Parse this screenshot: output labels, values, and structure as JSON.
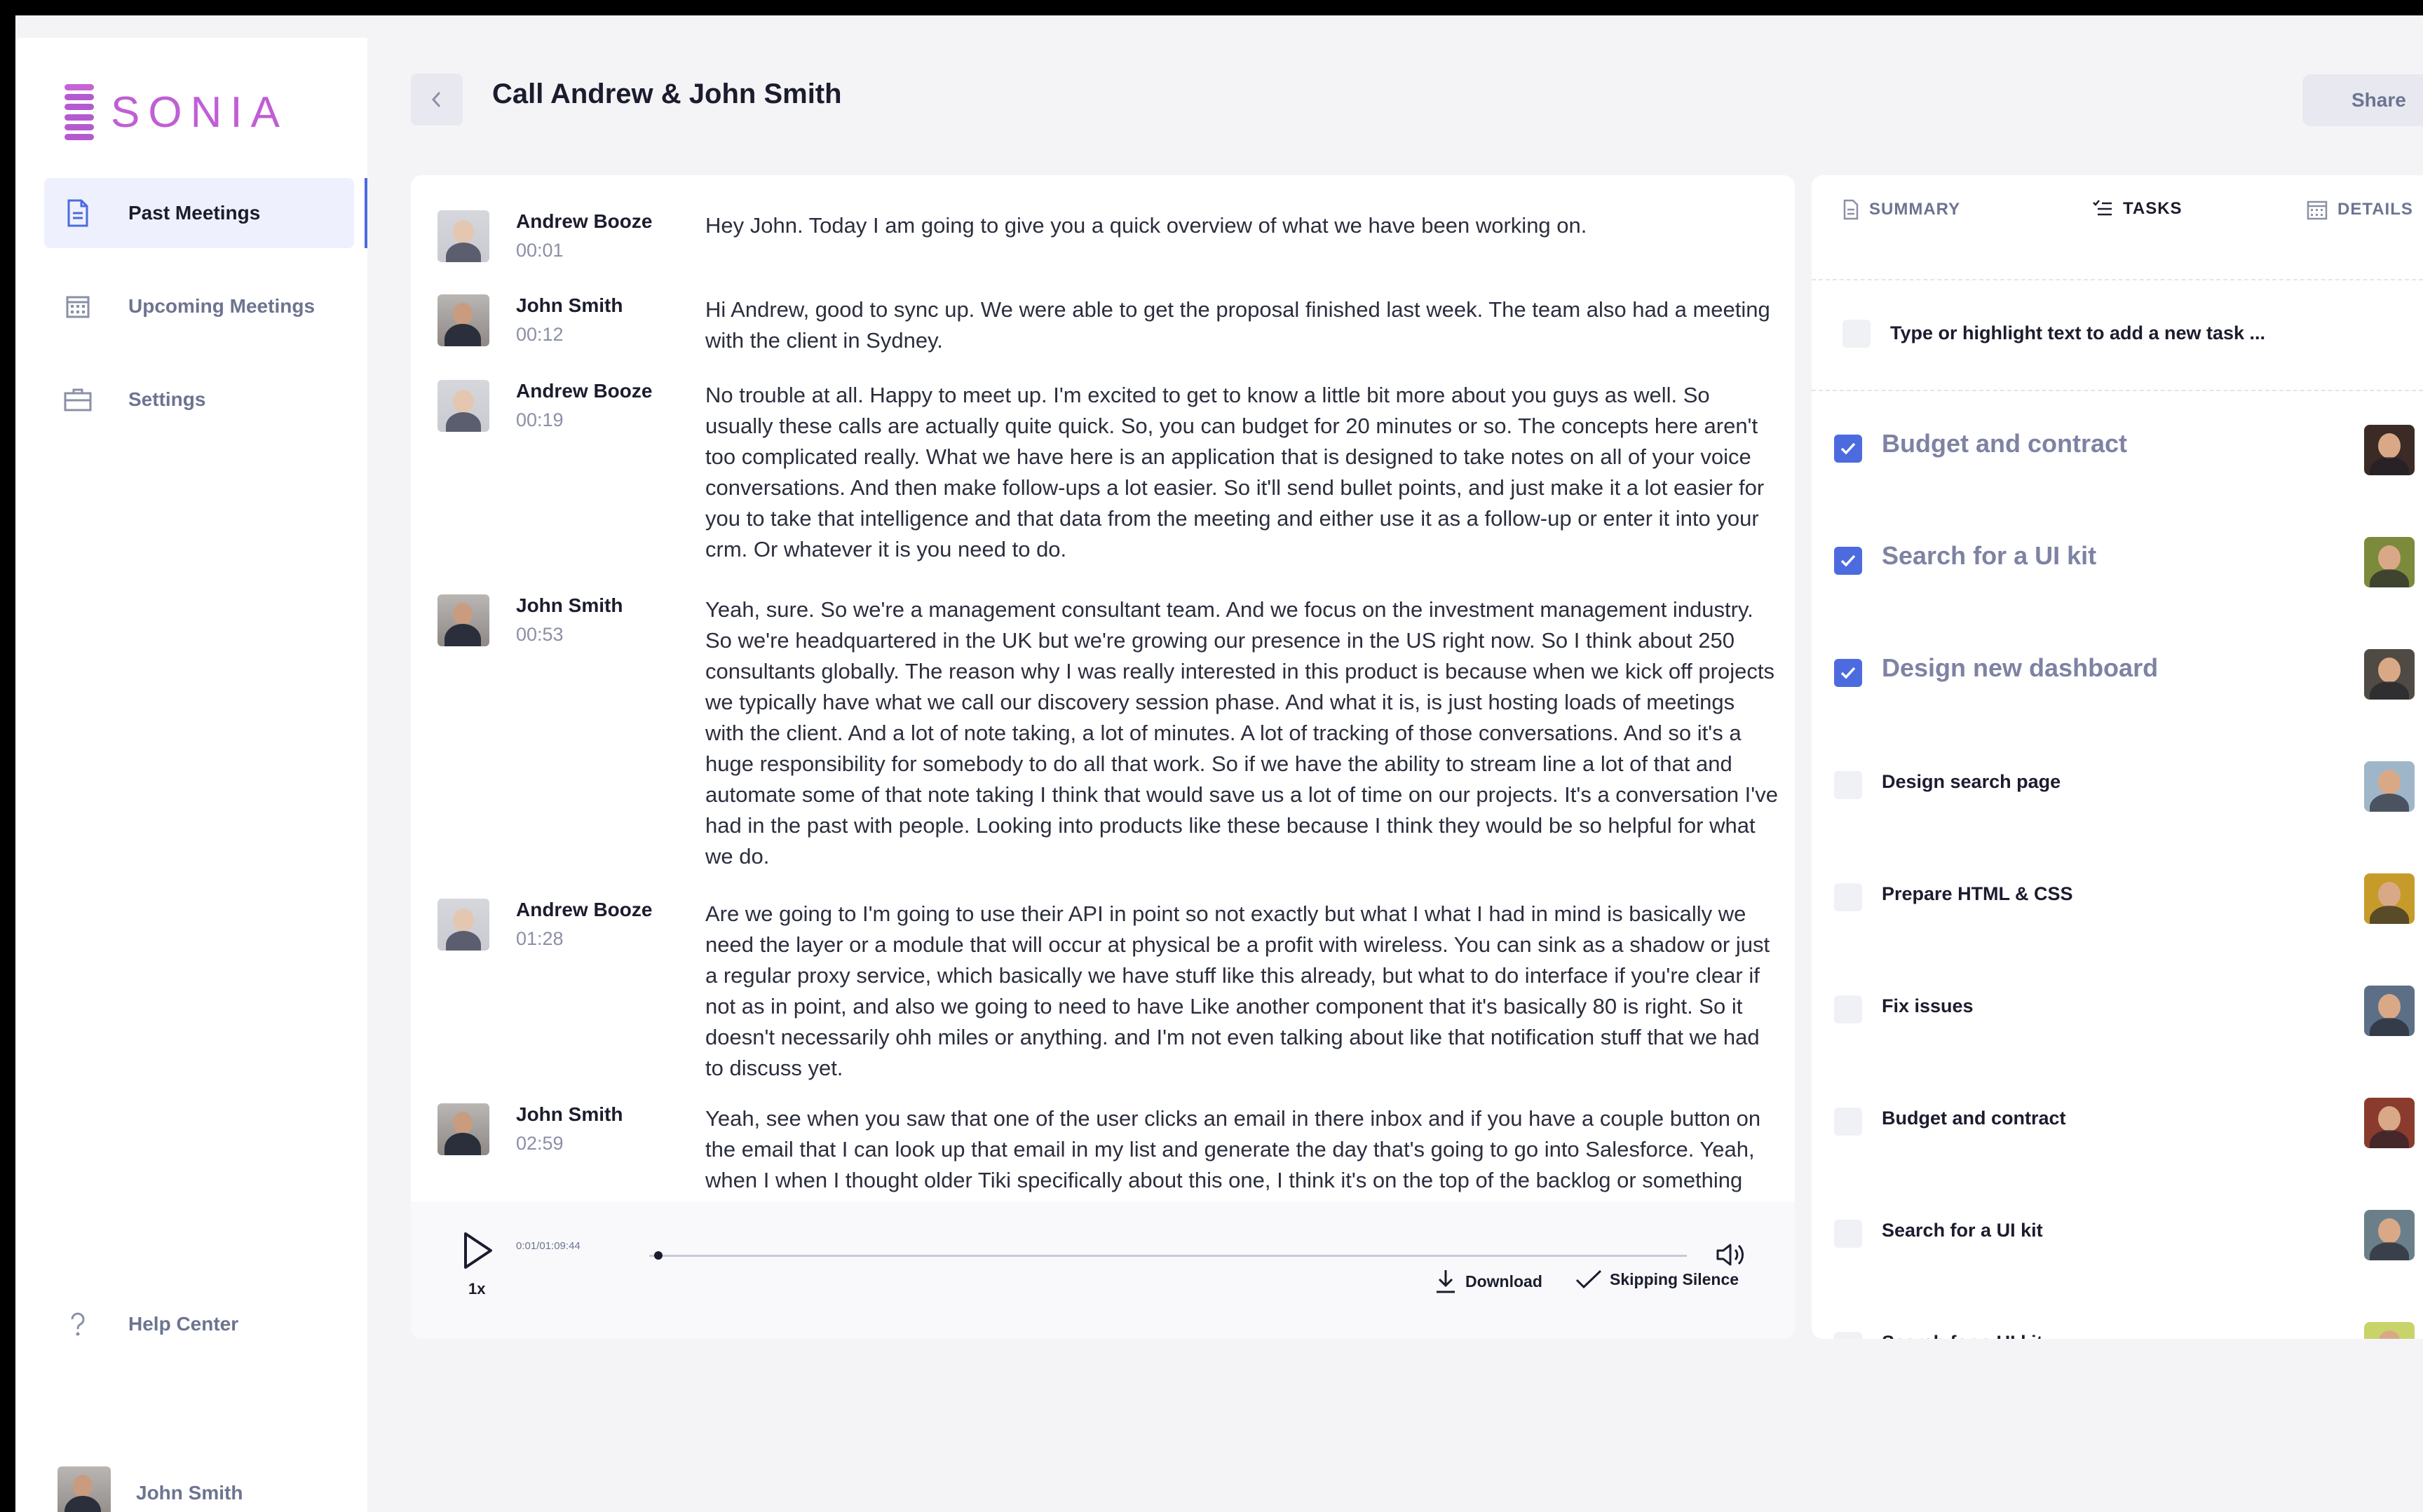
{
  "brand": {
    "name": "SONIA",
    "accent": "#c05ed6"
  },
  "sidebar": {
    "items": [
      {
        "label": "Past Meetings",
        "icon": "document-icon",
        "active": true
      },
      {
        "label": "Upcoming Meetings",
        "icon": "calendar-icon",
        "active": false
      },
      {
        "label": "Settings",
        "icon": "briefcase-icon",
        "active": false
      }
    ],
    "help_label": "Help Center",
    "user_name": "John Smith"
  },
  "header": {
    "title": "Call Andrew & John Smith",
    "share_label": "Share"
  },
  "transcript": [
    {
      "speaker": "Andrew Booze",
      "time": "00:01",
      "text": "Hey John. Today I am going to give you a quick overview of what we have been working on."
    },
    {
      "speaker": "John Smith",
      "time": "00:12",
      "text": "Hi Andrew, good to sync up. We were able to get the proposal finished last week. The team also had a meeting with the client in Sydney."
    },
    {
      "speaker": "Andrew Booze",
      "time": "00:19",
      "text": "No trouble at all. Happy to meet up. I'm excited to get to know a little bit more about you guys as well. So usually these calls are actually quite quick. So, you can budget for 20 minutes or so. The concepts here aren't too complicated really. What we have here is an application that is designed to take notes on all of your voice conversations. And then make follow-ups a lot easier. So it'll send bullet points, and just make it a lot easier for you to take that intelligence and that data from the meeting and either use it as a follow-up or enter it into your crm. Or whatever it is you need to do."
    },
    {
      "speaker": "John Smith",
      "time": "00:53",
      "text": "Yeah, sure. So we're a management consultant team. And we focus on the investment management industry. So we're headquartered in the UK but we're growing our presence in the US right now. So I think about 250 consultants globally. The reason why I was really interested in this product is because when we kick off projects we typically have what we call our discovery session phase. And what it is, is just hosting loads of meetings with the client. And a lot of note taking, a lot of minutes. A lot of tracking of those conversations. And so it's a huge responsibility for somebody to do all that work. So if we have the ability to stream line a lot of that and automate some of that note taking I think that would save us a lot of time on our projects. It's a conversation I've had in the past with people. Looking into products like these because I think they would be so helpful for what we do."
    },
    {
      "speaker": "Andrew Booze",
      "time": "01:28",
      "text": "Are we going to I'm going to use their API in point so not exactly but what I what I had in mind is basically we need the layer or a module that will occur at physical be a profit with wireless. You can sink as a shadow or just a regular proxy service, which basically we have stuff like this already, but what to do interface if you're clear if not as in point, and also we going to need to have Like another component that it's basically 80 is right. So it doesn't necessarily ohh miles or anything. and I'm not even talking about like that notification stuff that we had to discuss yet."
    },
    {
      "speaker": "John Smith",
      "time": "02:59",
      "text": "Yeah, see when you saw that one of the user clicks an email in there inbox and if you have a couple button on the email that I can look up that email in my list and generate the day that's going to go into Salesforce. Yeah, when I when I thought older Tiki specifically about this one, I think it's on the top of the backlog or something close to that like even that you have already active to Nilan and of course effective you just rocked it, but can be very simple for now. Just get a message. I did get a message inspect the league."
    }
  ],
  "player": {
    "time": "0:01/01:09:44",
    "progress": 0.005,
    "speed": "1x",
    "download_label": "Download",
    "skip_label": "Skipping Silence"
  },
  "tabs": [
    {
      "label": "SUMMARY",
      "icon": "document-icon",
      "active": false
    },
    {
      "label": "TASKS",
      "icon": "list-icon",
      "active": true
    },
    {
      "label": "DETAILS",
      "icon": "calendar-icon",
      "active": false
    }
  ],
  "new_task_placeholder": "Type or highlight text to add a new task ...",
  "tasks": [
    {
      "label": "Budget and contract",
      "done": true
    },
    {
      "label": "Search for a UI kit",
      "done": true
    },
    {
      "label": "Design new dashboard",
      "done": true
    },
    {
      "label": "Design search page",
      "done": false
    },
    {
      "label": "Prepare HTML & CSS",
      "done": false
    },
    {
      "label": "Fix issues",
      "done": false
    },
    {
      "label": "Budget and contract",
      "done": false
    },
    {
      "label": "Search for a UI kit",
      "done": false
    },
    {
      "label": "Search for a UI kit",
      "done": false
    }
  ]
}
